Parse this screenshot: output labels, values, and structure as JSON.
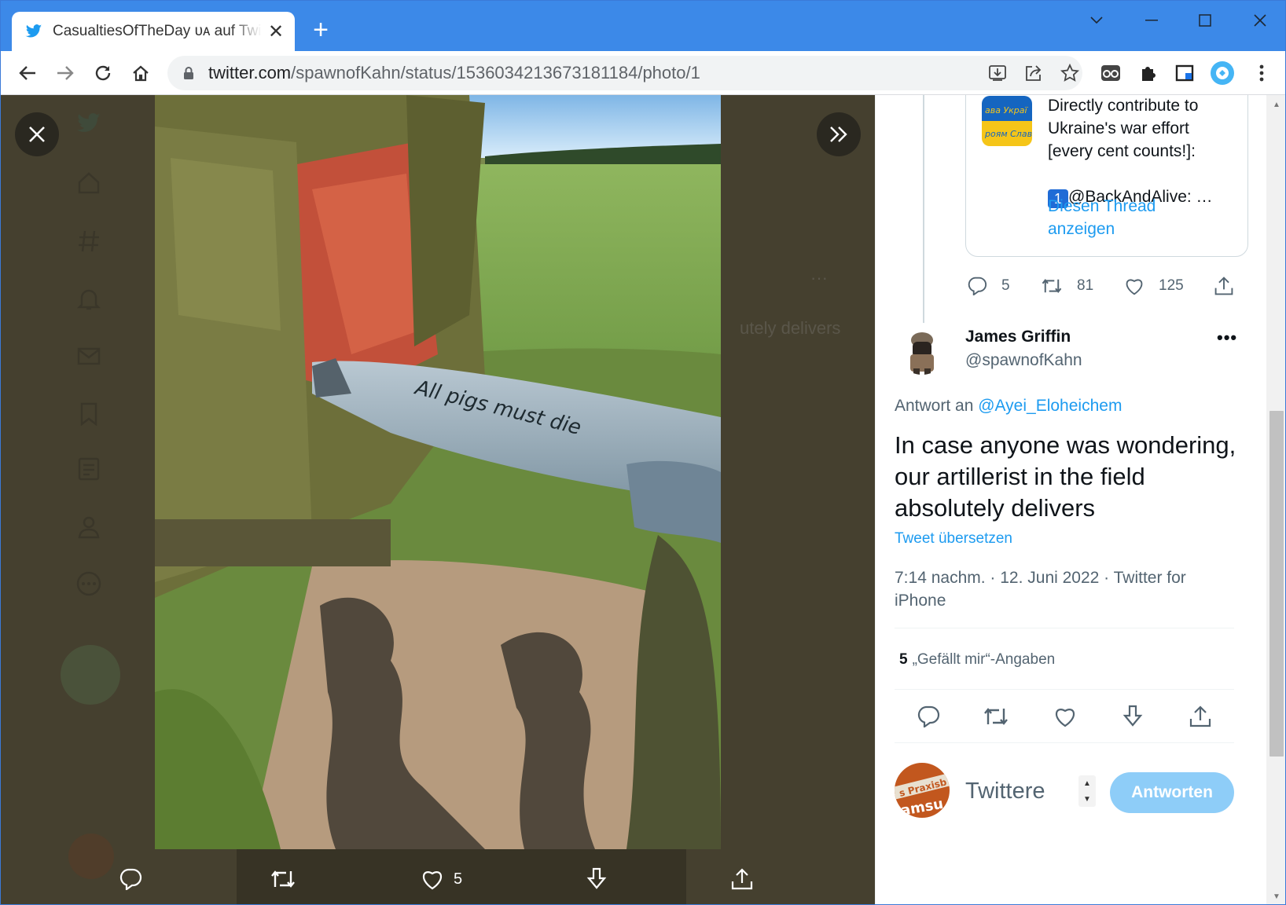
{
  "browser": {
    "tab_title": "CasualtiesOfTheDay ᴜᴀ auf Twitter",
    "url_host": "twitter.com",
    "url_path": "/spawnofKahn/status/1536034213673181184/photo/1",
    "new_tab_label": "+"
  },
  "lightbox": {
    "photo_caption_text": "All pigs must die",
    "like_count": "5",
    "ghost_text": "utely delivers"
  },
  "quote": {
    "text": "Directly contribute to\nUkraine's war effort\n[every cent counts!]:\n\n🟦@BackAndAlive: …",
    "keycap": "1",
    "mention": "@BackAndAlive: …",
    "thread_link": "Diesen Thread anzeigen",
    "replies": "5",
    "retweets": "81",
    "likes": "125",
    "avatar_text_top": "ава Украї",
    "avatar_text_bottom": "роям Слав"
  },
  "tweet": {
    "author_name": "James Griffin",
    "author_handle": "@spawnofKahn",
    "more_label": "•••",
    "reply_prefix": "Antwort an ",
    "reply_handle": "@Ayei_Eloheichem",
    "body": "In case anyone was wondering, our artillerist in the field absolutely delivers",
    "translate": "Tweet übersetzen",
    "meta": "7:14 nachm. · 12. Juni 2022 · Twitter for iPhone",
    "like_count": "5",
    "like_label": "„Gefällt mir“-Angaben"
  },
  "composer": {
    "placeholder": "Twittere",
    "button": "Antworten",
    "avatar_text_top": "s Praxisb",
    "avatar_text_bottom": "amsu"
  },
  "colors": {
    "chrome_blue": "#3c89e8",
    "twitter_blue": "#1d9bf0",
    "lightbox_bg": "#45402f",
    "reply_button_disabled": "#8ecdf8"
  }
}
